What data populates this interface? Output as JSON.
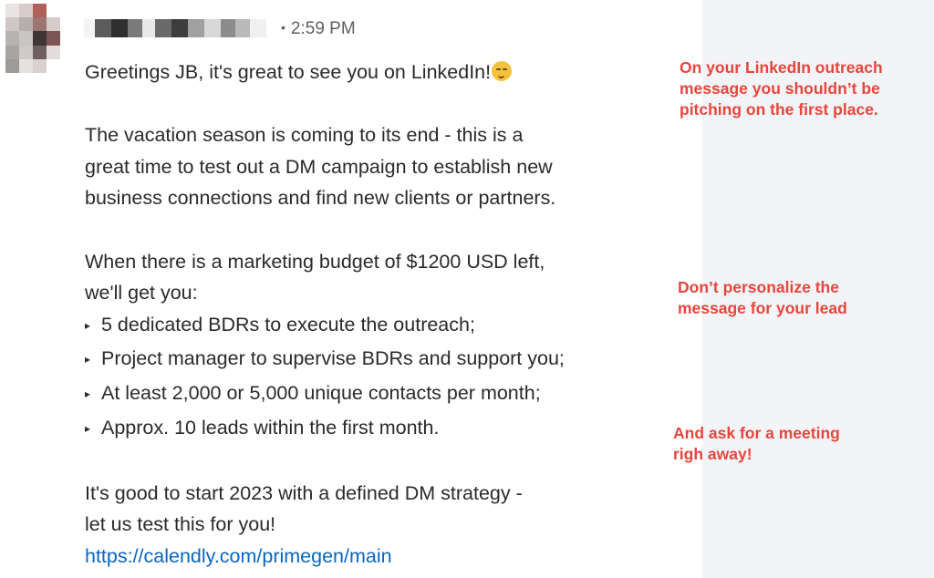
{
  "header": {
    "timestamp": "2:59 PM",
    "separator": "•"
  },
  "message": {
    "greeting": "Greetings JB, it's great to see you on LinkedIn!",
    "emoji": "smirking-face-emoji",
    "para1": [
      "The vacation season is coming to its end - this is a",
      "great time to test out a DM campaign to establish new",
      "business connections and find new clients or partners."
    ],
    "para2": [
      "When there is a marketing budget of $1200 USD left,",
      "we'll get you:"
    ],
    "bullet_mark": "▸",
    "bullets": [
      "5 dedicated BDRs to execute the outreach;",
      "Project manager to supervise BDRs and support you;",
      "At least 2,000 or 5,000 unique contacts per month;",
      "Approx. 10 leads within the first month."
    ],
    "closing": [
      "It's good to start 2023 with a defined DM strategy -",
      "let us test this for you!"
    ],
    "link": "https://calendly.com/primegen/main"
  },
  "annotations": [
    {
      "lines": [
        "On your LinkedIn outreach",
        "message you shouldn’t be",
        "pitching on the first place."
      ]
    },
    {
      "lines": [
        "Don’t personalize the",
        "message for your lead"
      ]
    },
    {
      "lines": [
        "And ask for a meeting",
        "righ away!"
      ]
    }
  ],
  "colors": {
    "annotation": "#e8453c",
    "link": "#0a66c2",
    "annotation_background": "#f3f4f8"
  }
}
